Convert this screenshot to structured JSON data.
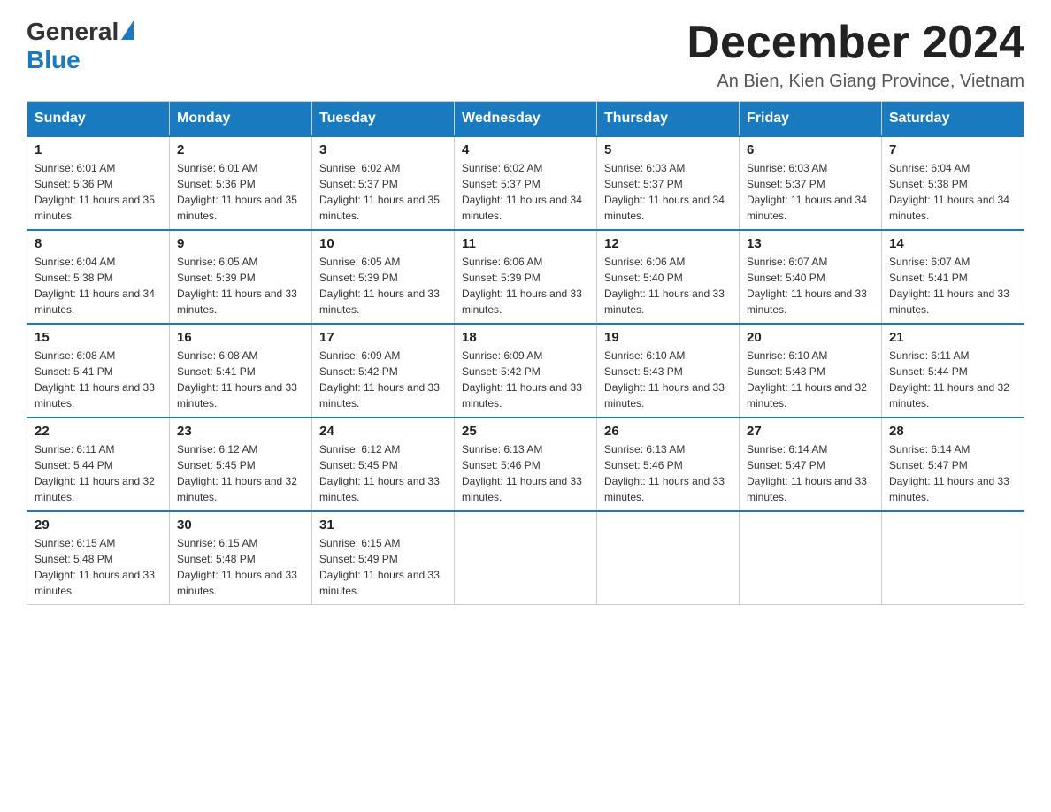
{
  "header": {
    "logo": {
      "general": "General",
      "blue": "Blue"
    },
    "title": "December 2024",
    "subtitle": "An Bien, Kien Giang Province, Vietnam"
  },
  "days_of_week": [
    "Sunday",
    "Monday",
    "Tuesday",
    "Wednesday",
    "Thursday",
    "Friday",
    "Saturday"
  ],
  "weeks": [
    [
      {
        "day": "1",
        "sunrise": "6:01 AM",
        "sunset": "5:36 PM",
        "daylight": "11 hours and 35 minutes."
      },
      {
        "day": "2",
        "sunrise": "6:01 AM",
        "sunset": "5:36 PM",
        "daylight": "11 hours and 35 minutes."
      },
      {
        "day": "3",
        "sunrise": "6:02 AM",
        "sunset": "5:37 PM",
        "daylight": "11 hours and 35 minutes."
      },
      {
        "day": "4",
        "sunrise": "6:02 AM",
        "sunset": "5:37 PM",
        "daylight": "11 hours and 34 minutes."
      },
      {
        "day": "5",
        "sunrise": "6:03 AM",
        "sunset": "5:37 PM",
        "daylight": "11 hours and 34 minutes."
      },
      {
        "day": "6",
        "sunrise": "6:03 AM",
        "sunset": "5:37 PM",
        "daylight": "11 hours and 34 minutes."
      },
      {
        "day": "7",
        "sunrise": "6:04 AM",
        "sunset": "5:38 PM",
        "daylight": "11 hours and 34 minutes."
      }
    ],
    [
      {
        "day": "8",
        "sunrise": "6:04 AM",
        "sunset": "5:38 PM",
        "daylight": "11 hours and 34 minutes."
      },
      {
        "day": "9",
        "sunrise": "6:05 AM",
        "sunset": "5:39 PM",
        "daylight": "11 hours and 33 minutes."
      },
      {
        "day": "10",
        "sunrise": "6:05 AM",
        "sunset": "5:39 PM",
        "daylight": "11 hours and 33 minutes."
      },
      {
        "day": "11",
        "sunrise": "6:06 AM",
        "sunset": "5:39 PM",
        "daylight": "11 hours and 33 minutes."
      },
      {
        "day": "12",
        "sunrise": "6:06 AM",
        "sunset": "5:40 PM",
        "daylight": "11 hours and 33 minutes."
      },
      {
        "day": "13",
        "sunrise": "6:07 AM",
        "sunset": "5:40 PM",
        "daylight": "11 hours and 33 minutes."
      },
      {
        "day": "14",
        "sunrise": "6:07 AM",
        "sunset": "5:41 PM",
        "daylight": "11 hours and 33 minutes."
      }
    ],
    [
      {
        "day": "15",
        "sunrise": "6:08 AM",
        "sunset": "5:41 PM",
        "daylight": "11 hours and 33 minutes."
      },
      {
        "day": "16",
        "sunrise": "6:08 AM",
        "sunset": "5:41 PM",
        "daylight": "11 hours and 33 minutes."
      },
      {
        "day": "17",
        "sunrise": "6:09 AM",
        "sunset": "5:42 PM",
        "daylight": "11 hours and 33 minutes."
      },
      {
        "day": "18",
        "sunrise": "6:09 AM",
        "sunset": "5:42 PM",
        "daylight": "11 hours and 33 minutes."
      },
      {
        "day": "19",
        "sunrise": "6:10 AM",
        "sunset": "5:43 PM",
        "daylight": "11 hours and 33 minutes."
      },
      {
        "day": "20",
        "sunrise": "6:10 AM",
        "sunset": "5:43 PM",
        "daylight": "11 hours and 32 minutes."
      },
      {
        "day": "21",
        "sunrise": "6:11 AM",
        "sunset": "5:44 PM",
        "daylight": "11 hours and 32 minutes."
      }
    ],
    [
      {
        "day": "22",
        "sunrise": "6:11 AM",
        "sunset": "5:44 PM",
        "daylight": "11 hours and 32 minutes."
      },
      {
        "day": "23",
        "sunrise": "6:12 AM",
        "sunset": "5:45 PM",
        "daylight": "11 hours and 32 minutes."
      },
      {
        "day": "24",
        "sunrise": "6:12 AM",
        "sunset": "5:45 PM",
        "daylight": "11 hours and 33 minutes."
      },
      {
        "day": "25",
        "sunrise": "6:13 AM",
        "sunset": "5:46 PM",
        "daylight": "11 hours and 33 minutes."
      },
      {
        "day": "26",
        "sunrise": "6:13 AM",
        "sunset": "5:46 PM",
        "daylight": "11 hours and 33 minutes."
      },
      {
        "day": "27",
        "sunrise": "6:14 AM",
        "sunset": "5:47 PM",
        "daylight": "11 hours and 33 minutes."
      },
      {
        "day": "28",
        "sunrise": "6:14 AM",
        "sunset": "5:47 PM",
        "daylight": "11 hours and 33 minutes."
      }
    ],
    [
      {
        "day": "29",
        "sunrise": "6:15 AM",
        "sunset": "5:48 PM",
        "daylight": "11 hours and 33 minutes."
      },
      {
        "day": "30",
        "sunrise": "6:15 AM",
        "sunset": "5:48 PM",
        "daylight": "11 hours and 33 minutes."
      },
      {
        "day": "31",
        "sunrise": "6:15 AM",
        "sunset": "5:49 PM",
        "daylight": "11 hours and 33 minutes."
      },
      null,
      null,
      null,
      null
    ]
  ]
}
